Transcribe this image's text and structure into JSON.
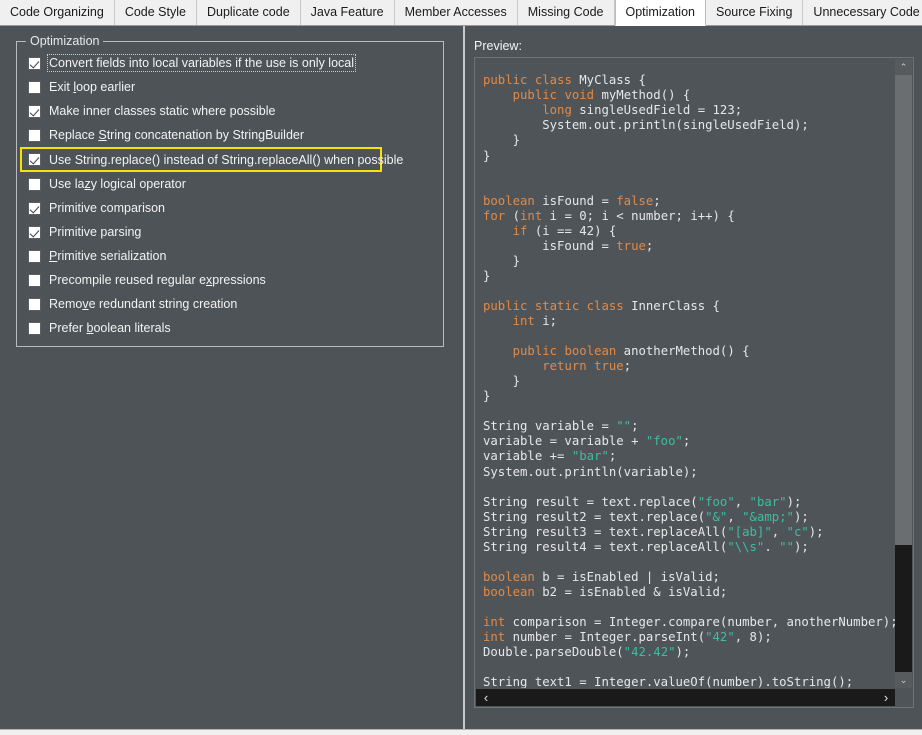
{
  "tabs": [
    {
      "label": "Code Organizing",
      "active": false
    },
    {
      "label": "Code Style",
      "active": false
    },
    {
      "label": "Duplicate code",
      "active": false
    },
    {
      "label": "Java Feature",
      "active": false
    },
    {
      "label": "Member Accesses",
      "active": false
    },
    {
      "label": "Missing Code",
      "active": false
    },
    {
      "label": "Optimization",
      "active": true
    },
    {
      "label": "Source Fixing",
      "active": false
    },
    {
      "label": "Unnecessary Code",
      "active": false
    }
  ],
  "left": {
    "groupbox_title": "Optimization",
    "options": [
      {
        "label": "Convert fields into local variables if the use is only local",
        "checked": true,
        "focused": true,
        "highlighted": false,
        "mnemonic": ""
      },
      {
        "label": "Exit loop earlier",
        "checked": false,
        "focused": false,
        "highlighted": false,
        "mnemonic": "l"
      },
      {
        "label": "Make inner classes static where possible",
        "checked": true,
        "focused": false,
        "highlighted": false,
        "mnemonic": ""
      },
      {
        "label": "Replace String concatenation by StringBuilder",
        "checked": false,
        "focused": false,
        "highlighted": false,
        "mnemonic": "S"
      },
      {
        "label": "Use String.replace() instead of String.replaceAll() when possible",
        "checked": true,
        "focused": false,
        "highlighted": true,
        "mnemonic": ""
      },
      {
        "label": "Use lazy logical operator",
        "checked": false,
        "focused": false,
        "highlighted": false,
        "mnemonic": "z"
      },
      {
        "label": "Primitive comparison",
        "checked": true,
        "focused": false,
        "highlighted": false,
        "mnemonic": ""
      },
      {
        "label": "Primitive parsing",
        "checked": true,
        "focused": false,
        "highlighted": false,
        "mnemonic": ""
      },
      {
        "label": "Primitive serialization",
        "checked": false,
        "focused": false,
        "highlighted": false,
        "mnemonic": "P"
      },
      {
        "label": "Precompile reused regular expressions",
        "checked": false,
        "focused": false,
        "highlighted": false,
        "mnemonic": "x"
      },
      {
        "label": "Remove redundant string creation",
        "checked": false,
        "focused": false,
        "highlighted": false,
        "mnemonic": "v"
      },
      {
        "label": "Prefer boolean literals",
        "checked": false,
        "focused": false,
        "highlighted": false,
        "mnemonic": "b"
      }
    ],
    "highlight_color": "#f5e400"
  },
  "right": {
    "preview_label": "Preview:",
    "code": "public class MyClass {\n    public void myMethod() {\n        long singleUsedField = 123;\n        System.out.println(singleUsedField);\n    }\n}\n\n\nboolean isFound = false;\nfor (int i = 0; i < number; i++) {\n    if (i == 42) {\n        isFound = true;\n    }\n}\n\npublic static class InnerClass {\n    int i;\n\n    public boolean anotherMethod() {\n        return true;\n    }\n}\n\nString variable = \"\";\nvariable = variable + \"foo\";\nvariable += \"bar\";\nSystem.out.println(variable);\n\nString result = text.replace(\"foo\", \"bar\");\nString result2 = text.replace(\"&\", \"&amp;\");\nString result3 = text.replaceAll(\"[ab]\", \"c\");\nString result4 = text.replaceAll(\"\\\\s\". \"\");\n\nboolean b = isEnabled | isValid;\nboolean b2 = isEnabled & isValid;\n\nint comparison = Integer.compare(number, anotherNumber);\nint number = Integer.parseInt(\"42\", 8);\nDouble.parseDouble(\"42.42\");\n\nString text1 = Integer.valueOf(number).toString();",
    "scroll": {
      "up_arrow": "⌃",
      "down_arrow": "⌄",
      "left_arrow": "‹",
      "right_arrow": "›"
    },
    "syntax_colors": {
      "keyword": "#e08a48",
      "string": "#3dbf9c",
      "plain": "#e6e7e8",
      "background": "#4f5458"
    }
  }
}
